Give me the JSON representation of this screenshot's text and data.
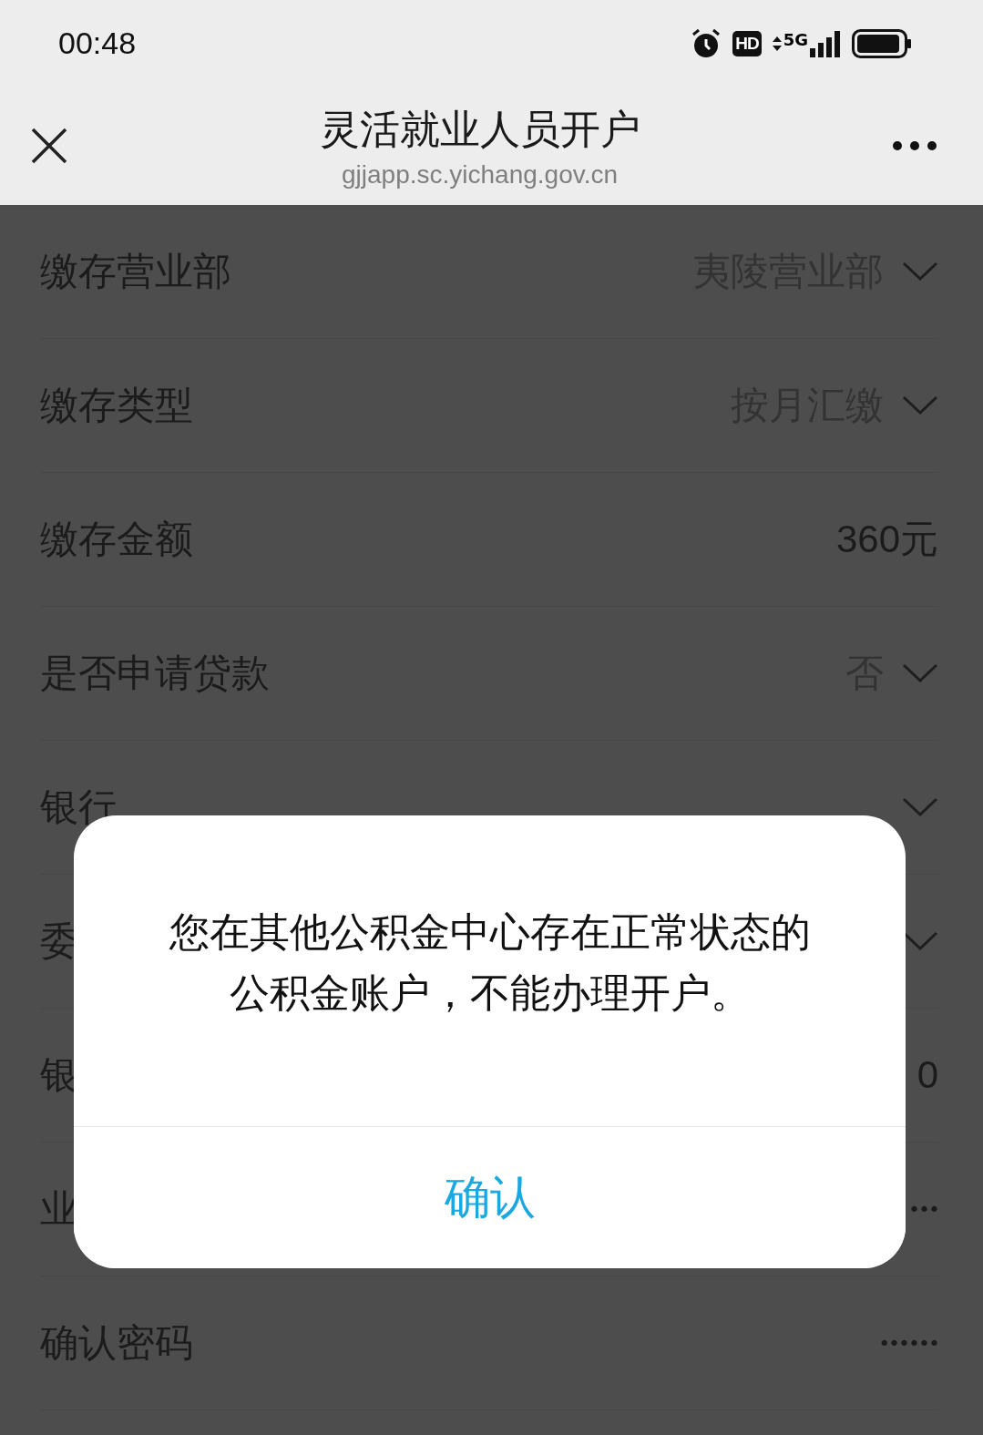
{
  "status_bar": {
    "time": "00:48",
    "network": "5G",
    "badge": "HD"
  },
  "header": {
    "title": "灵活就业人员开户",
    "url": "gjjapp.sc.yichang.gov.cn"
  },
  "form": {
    "rows": [
      {
        "label": "缴存营业部",
        "value": "夷陵营业部",
        "kind": "select"
      },
      {
        "label": "缴存类型",
        "value": "按月汇缴",
        "kind": "select"
      },
      {
        "label": "缴存金额",
        "value": "360元",
        "kind": "text"
      },
      {
        "label": "是否申请贷款",
        "value": "否",
        "kind": "select"
      },
      {
        "label": "银行",
        "kind": "select"
      },
      {
        "label": "委",
        "kind": "select"
      },
      {
        "label": "银",
        "value": "0",
        "kind": "text"
      },
      {
        "label": "业",
        "value": "•••",
        "kind": "password"
      },
      {
        "label": "确认密码",
        "value": "••••••",
        "kind": "password"
      }
    ]
  },
  "dialog": {
    "message": "您在其他公积金中心存在正常状态的公积金账户，不能办理开户。",
    "button": "确认"
  }
}
